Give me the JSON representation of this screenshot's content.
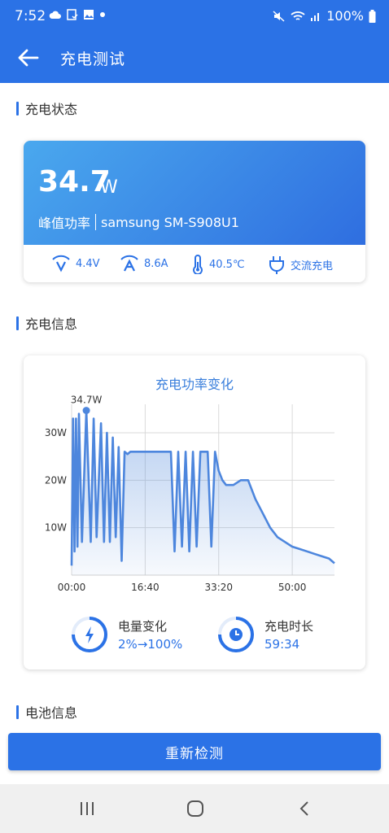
{
  "status_bar": {
    "time": "7:52",
    "battery": "100%"
  },
  "app_bar": {
    "title": "充电测试"
  },
  "sections": {
    "charge_status": "充电状态",
    "charge_info": "充电信息",
    "battery_info": "电池信息"
  },
  "power": {
    "value": "34.7",
    "unit": "W",
    "label": "峰值功率",
    "device": "samsung SM-S908U1",
    "voltage": "4.4V",
    "current": "8.6A",
    "temperature": "40.5℃",
    "charge_type": "交流充电"
  },
  "chart_data": {
    "type": "line",
    "title": "充电功率变化",
    "x_ticks": [
      "00:00",
      "16:40",
      "33:20",
      "50:00"
    ],
    "y_ticks": [
      "10W",
      "20W",
      "30W"
    ],
    "peak_label": "34.7W",
    "ylim": [
      0,
      36
    ],
    "x_range_seconds": [
      0,
      3574
    ],
    "series": [
      {
        "values_time_seconds": [
          0,
          20,
          40,
          60,
          80,
          100,
          140,
          200,
          260,
          300,
          340,
          400,
          440,
          480,
          520,
          560,
          600,
          640,
          680,
          720,
          760,
          800,
          900,
          1000,
          1100,
          1200,
          1300,
          1350,
          1400,
          1450,
          1500,
          1550,
          1600,
          1650,
          1700,
          1750,
          1800,
          1850,
          1900,
          1950,
          2000,
          2050,
          2100,
          2200,
          2300,
          2400,
          2500,
          2600,
          2700,
          2800,
          2900,
          3000,
          3100,
          3200,
          3300,
          3400,
          3500,
          3574
        ],
        "values_watts": [
          2,
          33,
          5,
          33,
          6,
          34,
          7,
          34.7,
          7,
          33,
          8,
          32,
          7,
          30,
          7,
          29,
          8,
          27,
          3,
          26,
          25.5,
          26,
          26,
          26,
          26,
          26,
          26,
          26,
          5,
          26,
          6,
          26,
          5,
          26,
          6,
          26,
          26,
          26,
          6,
          26,
          22,
          20,
          19,
          19,
          20,
          20,
          16,
          13,
          10,
          8,
          7,
          6,
          5.5,
          5,
          4.5,
          4,
          3.5,
          2.5
        ]
      }
    ]
  },
  "battery_stats": {
    "level_label": "电量变化",
    "level_value": "2%→100%",
    "duration_label": "充电时长",
    "duration_value": "59:34"
  },
  "button": {
    "label": "重新检测"
  }
}
